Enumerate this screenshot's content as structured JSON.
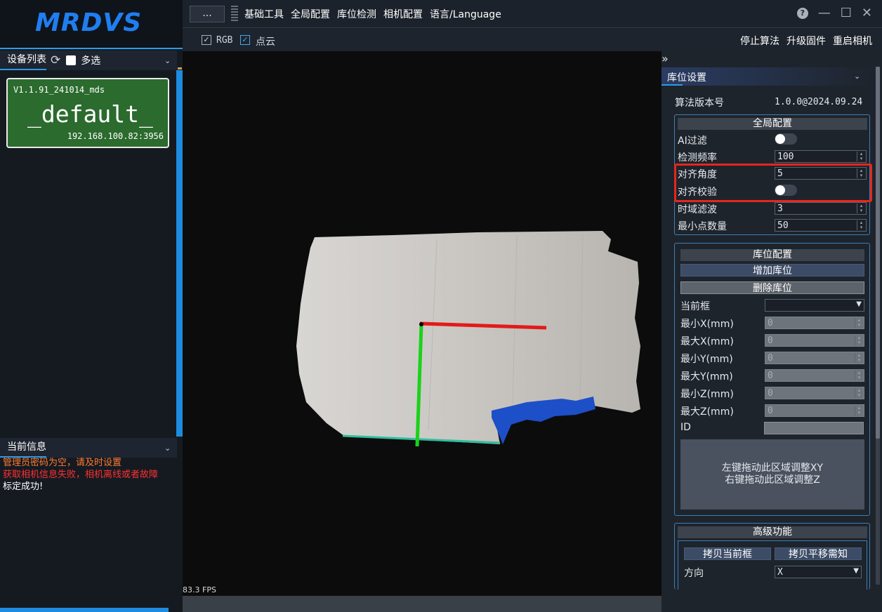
{
  "app": {
    "logo": "MRDVS"
  },
  "top_menu": {
    "more_button": "...",
    "items": [
      "基础工具",
      "全局配置",
      "库位检测",
      "相机配置",
      "语言/Language"
    ],
    "help": "?",
    "minimize": "—",
    "maximize": "☐",
    "close": "✕"
  },
  "toolbar": {
    "rgb_label": "RGB",
    "pointcloud_label": "点云",
    "rgb_checked": true,
    "pointcloud_checked": true,
    "actions": [
      "停止算法",
      "升级固件",
      "重启相机"
    ]
  },
  "device_list": {
    "title": "设备列表",
    "multi_select": "多选",
    "device": {
      "version": "V1.1.91_241014_mds",
      "name": "_default_",
      "ip": "192.168.100.82:3956"
    }
  },
  "current_info": {
    "title": "当前信息",
    "lines": [
      {
        "text": "管理员密码为空，请及时设置",
        "color": "#ff7a30"
      },
      {
        "text": "获取相机信息失败，相机离线或者故障",
        "color": "#ff3030"
      },
      {
        "text": "标定成功!",
        "color": "#ffffff"
      }
    ]
  },
  "viewport": {
    "fps": "83.3 FPS"
  },
  "bin_settings": {
    "title": "库位设置",
    "algo_version_label": "算法版本号",
    "algo_version": "1.0.0@2024.09.24",
    "global": {
      "title": "全局配置",
      "ai_filter": {
        "label": "AI过滤",
        "on": false
      },
      "detect_freq": {
        "label": "检测频率",
        "value": "100"
      },
      "align_angle": {
        "label": "对齐角度",
        "value": "5"
      },
      "align_check": {
        "label": "对齐校验",
        "on": false
      },
      "time_filter": {
        "label": "时域滤波",
        "value": "3"
      },
      "min_points": {
        "label": "最小点数量",
        "value": "50"
      }
    },
    "bin_config": {
      "title": "库位配置",
      "add": "增加库位",
      "delete": "删除库位",
      "current_frame_label": "当前框",
      "current_frame_value": "",
      "fields": [
        {
          "label": "最小X(mm)",
          "value": "0"
        },
        {
          "label": "最大X(mm)",
          "value": "0"
        },
        {
          "label": "最小Y(mm)",
          "value": "0"
        },
        {
          "label": "最大Y(mm)",
          "value": "0"
        },
        {
          "label": "最小Z(mm)",
          "value": "0"
        },
        {
          "label": "最大Z(mm)",
          "value": "0"
        }
      ],
      "id_label": "ID",
      "drag_hint_1": "左键拖动此区域调整XY",
      "drag_hint_2": "右键拖动此区域调整Z"
    },
    "advanced": {
      "title": "高级功能",
      "copy_frame": "拷贝当前框",
      "copy_shift": "拷贝平移需知",
      "direction_label": "方向",
      "direction_value": "X"
    }
  },
  "colors": {
    "accent": "#2d9be8",
    "device_card": "#2b6b2e",
    "highlight": "#e5261e"
  }
}
